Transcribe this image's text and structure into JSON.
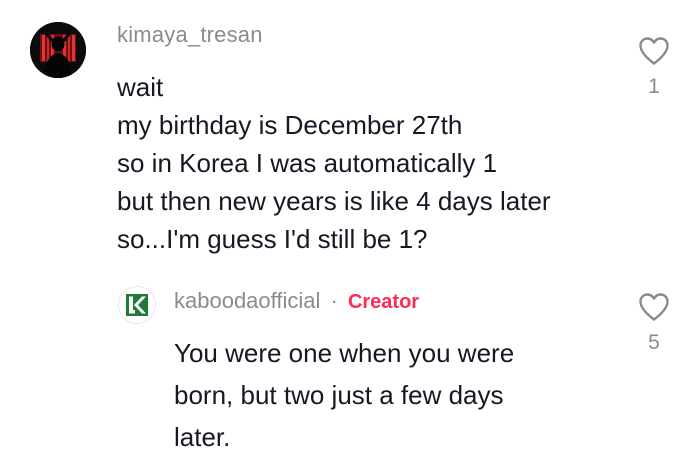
{
  "comment": {
    "username": "kimaya_tresan",
    "lines": [
      "wait",
      "my birthday is December 27th",
      "so in Korea I was automatically 1",
      "but then new years is like 4 days later",
      "so...I'm guess I'd still be 1?"
    ],
    "like_count": "1",
    "like_icon": "heart-outline-icon",
    "avatar": "user-silhouette-avatar"
  },
  "reply": {
    "username": "kaboodaofficial",
    "separator": "·",
    "badge": "Creator",
    "lines": [
      "You were one when you were",
      "born, but two just a few days",
      "later."
    ],
    "like_count": "5",
    "like_icon": "heart-outline-icon",
    "avatar": "kabooda-logo-avatar"
  },
  "colors": {
    "text_primary": "#161823",
    "text_secondary": "#8a8b91",
    "creator_accent": "#fe2c55",
    "brand_green": "#1f7a3a"
  }
}
